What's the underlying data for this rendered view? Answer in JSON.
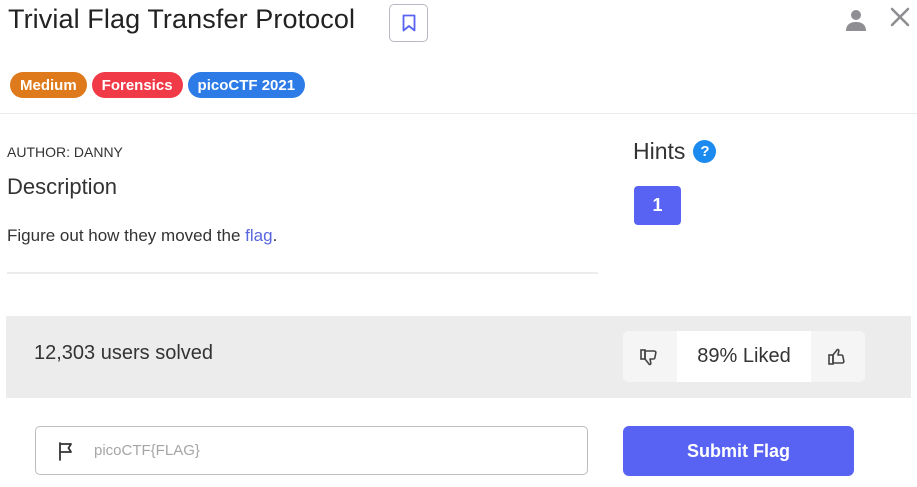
{
  "header": {
    "title": "Trivial Flag Transfer Protocol",
    "bookmark_icon": "bookmark-icon",
    "user_icon": "user-icon",
    "close_icon": "close-icon"
  },
  "tags": [
    {
      "label": "Medium",
      "color": "#df7a1c"
    },
    {
      "label": "Forensics",
      "color": "#f03a47"
    },
    {
      "label": "picoCTF 2021",
      "color": "#2d7be7"
    }
  ],
  "description": {
    "author": "AUTHOR: DANNY",
    "heading": "Description",
    "text_before": "Figure out how they moved the ",
    "link_text": "flag",
    "text_after": "."
  },
  "hints": {
    "heading": "Hints",
    "help_symbol": "?",
    "items": [
      {
        "label": "1"
      }
    ]
  },
  "stats": {
    "solved": "12,303 users solved",
    "liked": "89% Liked"
  },
  "submission": {
    "placeholder": "picoCTF{FLAG}",
    "submit_label": "Submit Flag"
  },
  "colors": {
    "accent": "#5863f4",
    "link": "#5865e0",
    "help": "#1c8bf0"
  }
}
